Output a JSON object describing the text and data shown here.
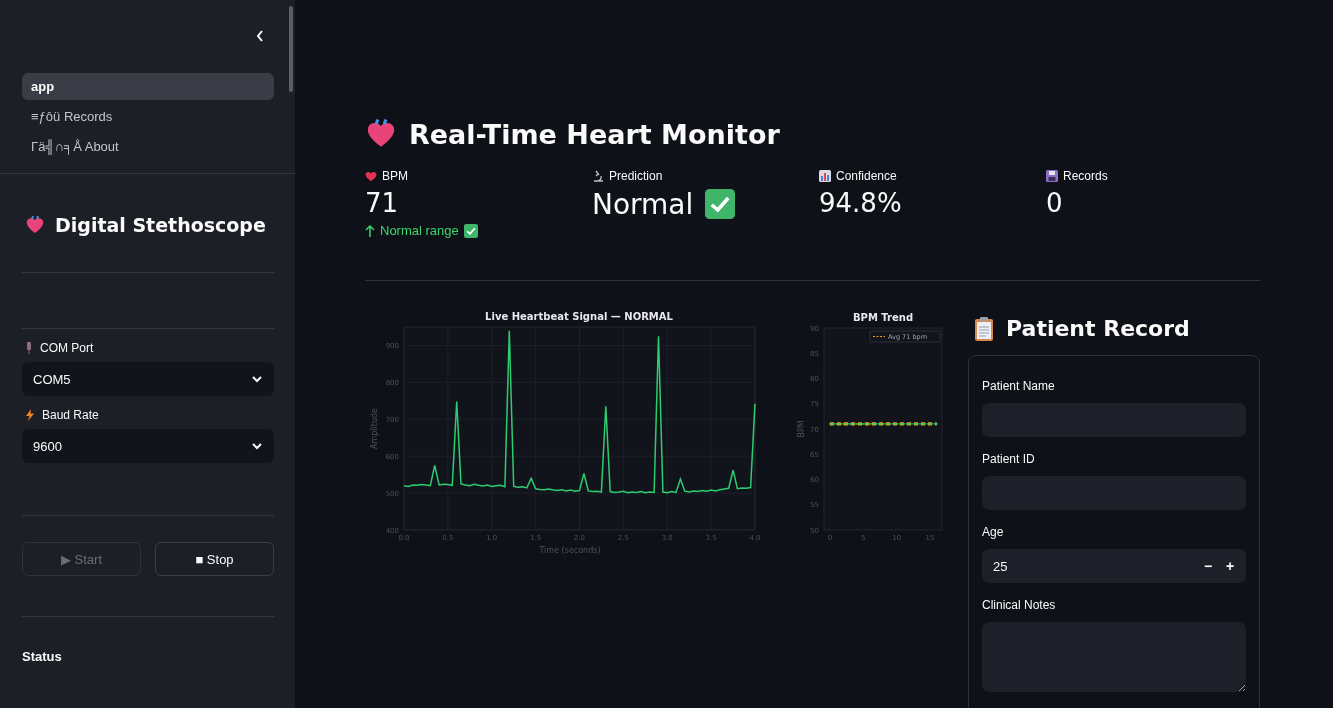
{
  "sidebar": {
    "nav": [
      {
        "label": "app",
        "selected": true
      },
      {
        "label": "≡ƒôü Records",
        "selected": false
      },
      {
        "label": "Γä╣∩╕Å About",
        "selected": false
      }
    ],
    "title": "Digital Stethoscope",
    "fields": [
      {
        "label": "COM Port",
        "value": "COM5"
      },
      {
        "label": "Baud Rate",
        "value": "9600"
      }
    ],
    "buttons": [
      {
        "label": "▶ Start",
        "disabled": true
      },
      {
        "label": "■ Stop",
        "disabled": false
      }
    ],
    "status_heading": "Status"
  },
  "main": {
    "title": "Real-Time Heart Monitor",
    "metrics": [
      {
        "label": "BPM",
        "value": "71",
        "kind": "number",
        "delta": "Normal range"
      },
      {
        "label": "Prediction",
        "value": "Normal",
        "kind": "status"
      },
      {
        "label": "Confidence",
        "value": "94.8%",
        "kind": "number"
      },
      {
        "label": "Records",
        "value": "0",
        "kind": "number"
      }
    ],
    "signal_chart": {
      "chart_data": {
        "type": "line",
        "grid": true,
        "title": "Live Heartbeat Signal — NORMAL",
        "xlabel": "Time (seconds)",
        "ylabel": "Amplitude",
        "xlim": [
          0,
          4
        ],
        "ylim": [
          400,
          950
        ],
        "xticks": [
          {
            "value": 0,
            "label": "0.0"
          },
          {
            "value": 0.5,
            "label": "0.5"
          },
          {
            "value": 1,
            "label": "1.0"
          },
          {
            "value": 1.5,
            "label": "1.5"
          },
          {
            "value": 2,
            "label": "2.0"
          },
          {
            "value": 2.5,
            "label": "2.5"
          },
          {
            "value": 3,
            "label": "3.0"
          },
          {
            "value": 3.5,
            "label": "3.5"
          },
          {
            "value": 4,
            "label": "4.0"
          }
        ],
        "yticks": [
          400,
          500,
          600,
          700,
          800,
          900
        ],
        "x": [
          0,
          0.05,
          0.1,
          0.15,
          0.2,
          0.25,
          0.3,
          0.35,
          0.4,
          0.45,
          0.5,
          0.55,
          0.6,
          0.65,
          0.7,
          0.75,
          0.8,
          0.85,
          0.9,
          0.95,
          1,
          1.05,
          1.1,
          1.15,
          1.2,
          1.25,
          1.3,
          1.35,
          1.4,
          1.45,
          1.5,
          1.55,
          1.6,
          1.65,
          1.7,
          1.75,
          1.8,
          1.85,
          1.9,
          1.95,
          2,
          2.05,
          2.1,
          2.15,
          2.2,
          2.25,
          2.3,
          2.35,
          2.4,
          2.45,
          2.5,
          2.55,
          2.6,
          2.65,
          2.7,
          2.75,
          2.8,
          2.85,
          2.9,
          2.95,
          3,
          3.05,
          3.1,
          3.15,
          3.2,
          3.25,
          3.3,
          3.35,
          3.4,
          3.45,
          3.5,
          3.55,
          3.6,
          3.65,
          3.7,
          3.75,
          3.8,
          3.85,
          3.9,
          3.95,
          4
        ],
        "values": [
          520,
          518,
          522,
          521,
          523,
          522,
          520,
          575,
          522,
          524,
          523,
          521,
          748,
          525,
          522,
          520,
          524,
          521,
          519,
          522,
          518,
          520,
          521,
          517,
          940,
          518,
          516,
          517,
          514,
          540,
          512,
          510,
          509,
          511,
          508,
          507,
          509,
          506,
          508,
          505,
          507,
          553,
          506,
          504,
          505,
          503,
          735,
          504,
          502,
          503,
          505,
          501,
          503,
          502,
          504,
          501,
          503,
          502,
          925,
          503,
          501,
          504,
          502,
          538,
          505,
          503,
          506,
          504,
          507,
          505,
          508,
          506,
          509,
          511,
          513,
          562,
          512,
          514,
          513,
          515,
          742
        ]
      }
    },
    "trend_chart": {
      "chart_data": {
        "type": "line",
        "title": "BPM Trend",
        "ylabel": "BPM",
        "xlim": [
          -0.9,
          16.8
        ],
        "ylim": [
          50,
          90
        ],
        "xticks": [
          0,
          5,
          10,
          15
        ],
        "yticks": [
          50,
          55,
          60,
          65,
          70,
          75,
          80,
          85,
          90
        ],
        "x": [
          0,
          1,
          2,
          3,
          4,
          5,
          6,
          7,
          8,
          9,
          10,
          11,
          12,
          13,
          14,
          15,
          16
        ],
        "series": [
          {
            "color": "#2ecc71",
            "values": [
              71,
              71,
              71,
              71,
              71,
              71,
              71,
              71,
              71,
              71,
              71,
              71,
              71,
              71,
              71,
              71,
              71
            ]
          },
          {
            "name": "Avg 71 bpm",
            "color": "#f39c12",
            "line_style": "dashed",
            "values": [
              71,
              71,
              71,
              71,
              71,
              71,
              71,
              71,
              71,
              71,
              71,
              71,
              71,
              71,
              71,
              71,
              71
            ]
          }
        ]
      }
    },
    "record": {
      "title": "Patient Record",
      "fields": [
        {
          "label": "Patient Name",
          "kind": "text"
        },
        {
          "label": "Patient ID",
          "kind": "text"
        },
        {
          "label": "Age",
          "kind": "number",
          "value": "25",
          "minus": "−",
          "plus": "+"
        },
        {
          "label": "Clinical Notes",
          "kind": "textarea"
        }
      ]
    }
  }
}
